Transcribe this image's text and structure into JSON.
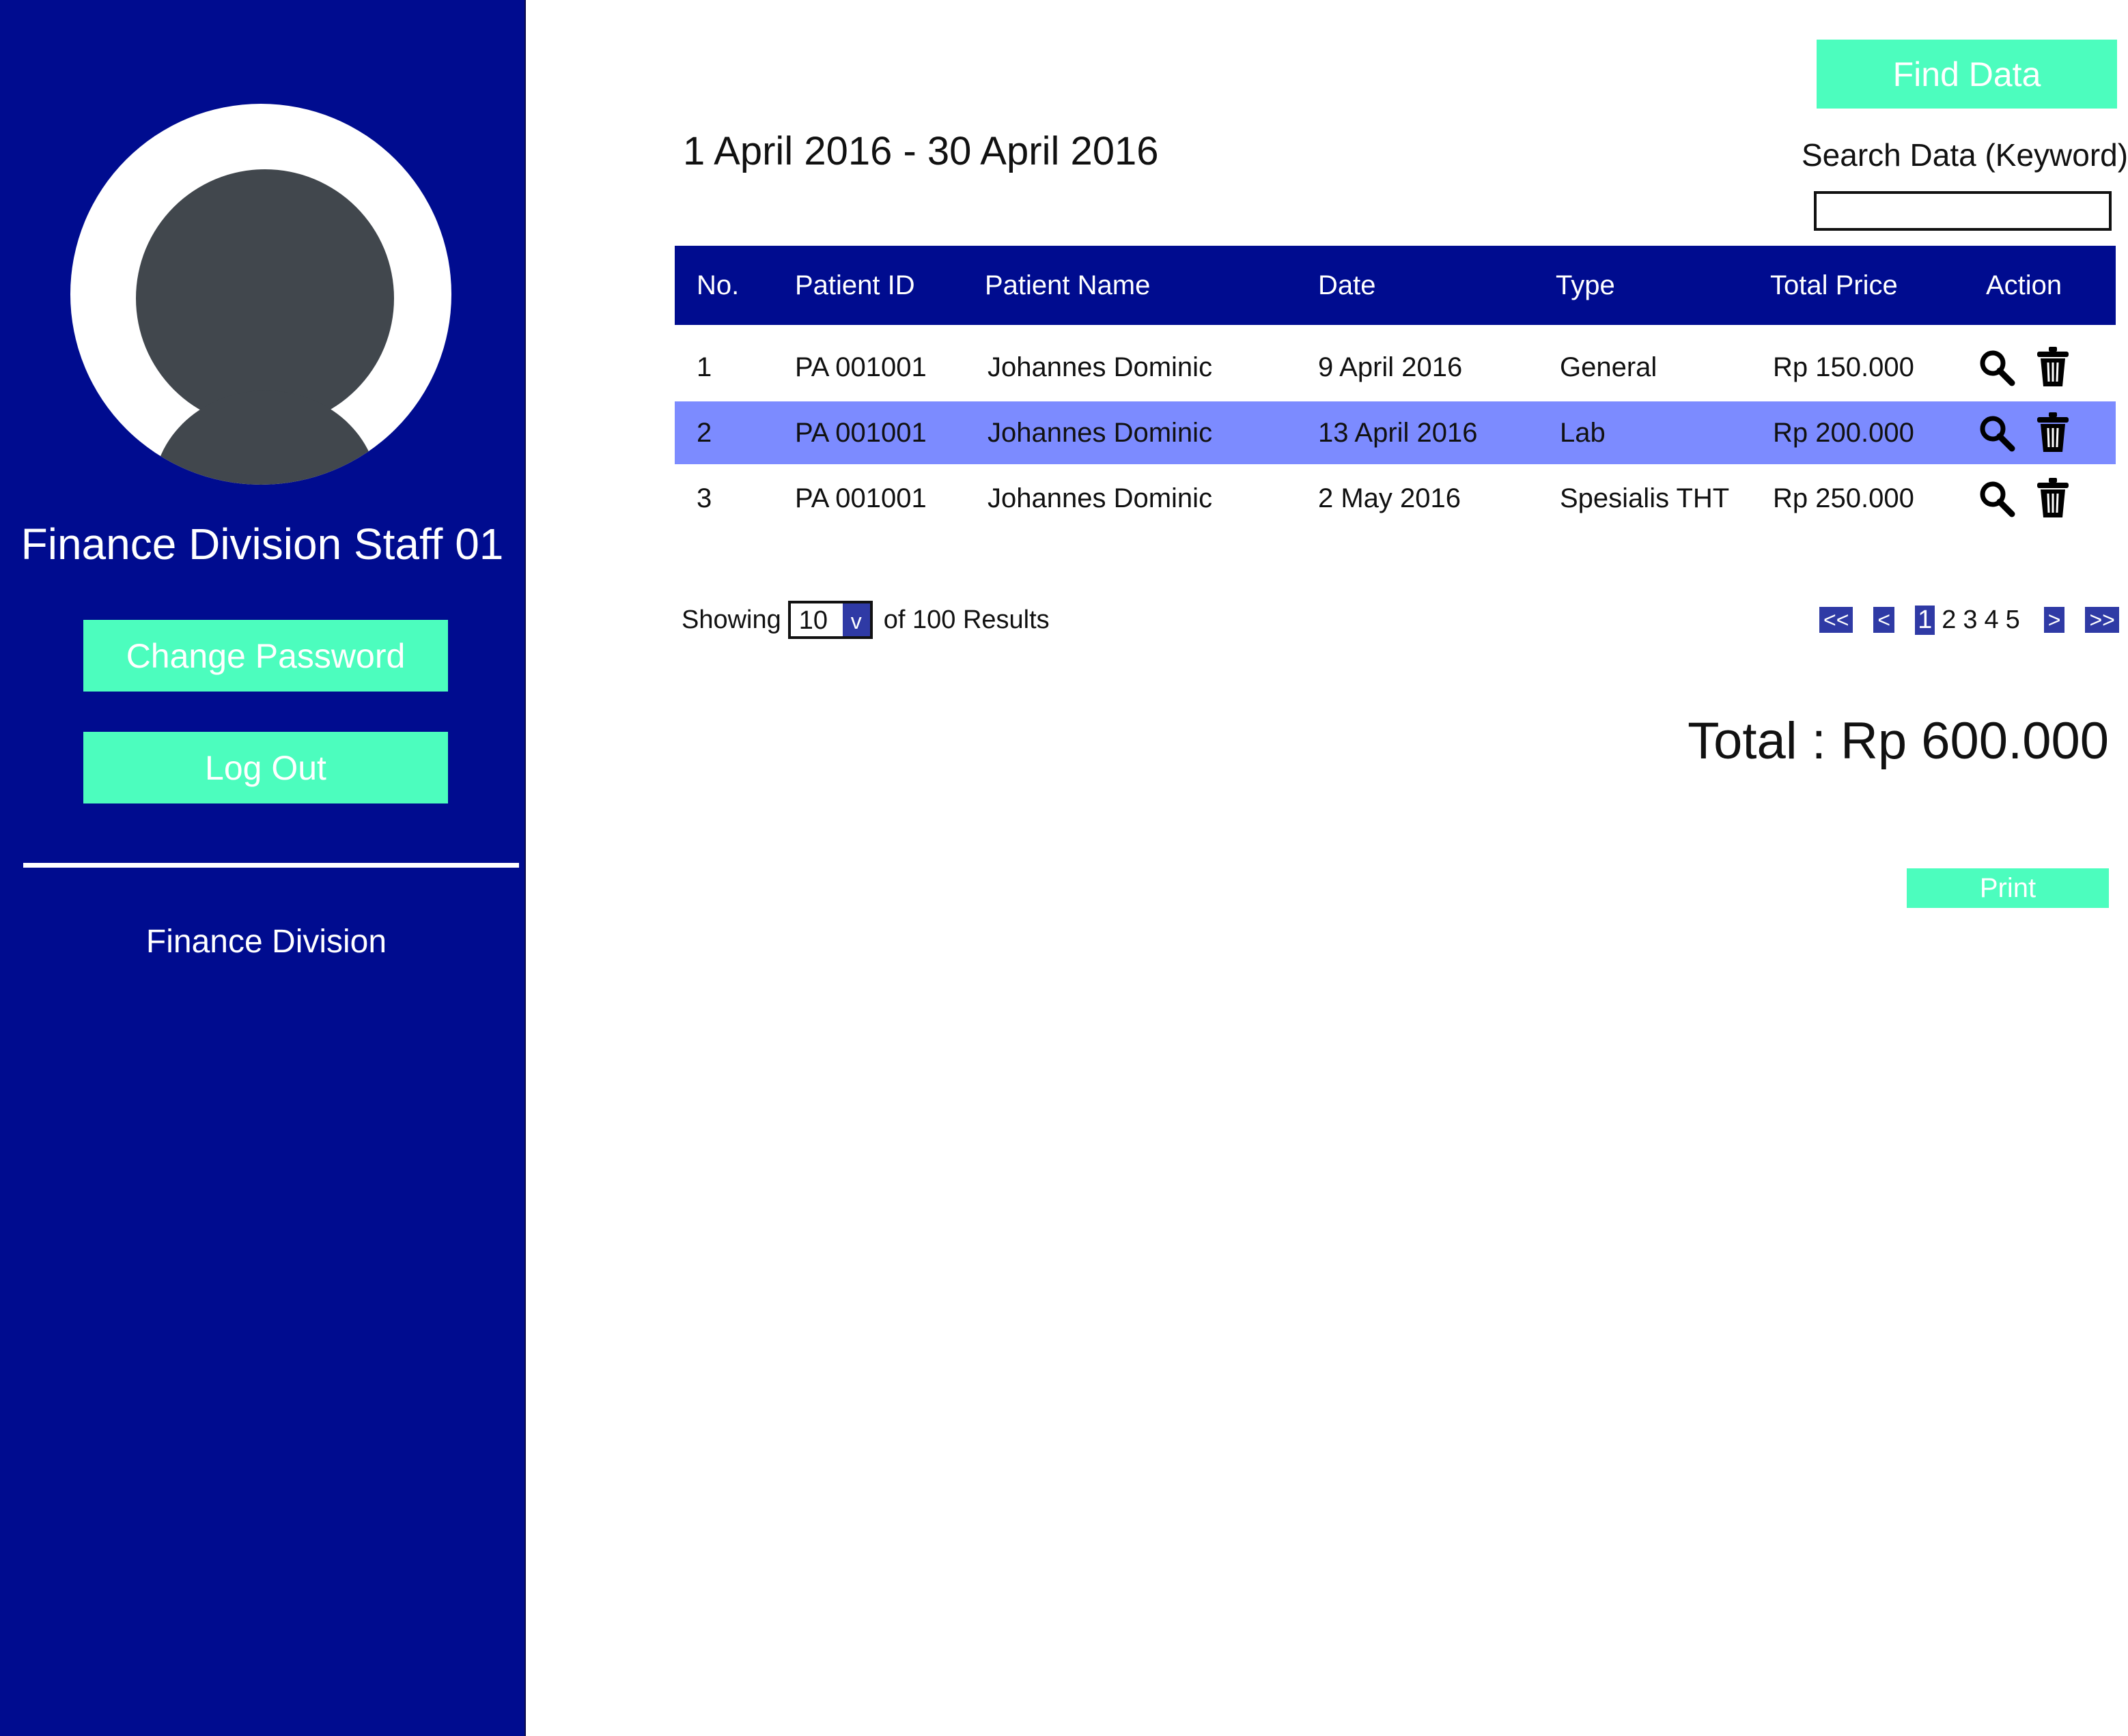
{
  "colors": {
    "sidebar_bg": "#000c8f",
    "accent_button": "#4cfdbe",
    "row_highlight": "#7c8bff",
    "avatar_silhouette": "#41474d",
    "pager_button": "#2f3aa5"
  },
  "sidebar": {
    "avatar_icon": "user-avatar-icon",
    "staff_name": "Finance Division Staff 01",
    "change_password_label": "Change Password",
    "logout_label": "Log Out",
    "section_label": "Finance Division"
  },
  "header": {
    "find_button_label": "Find Data",
    "date_range": "1 April 2016 - 30 April 2016",
    "search_label": "Search Data (Keyword)",
    "search_value": ""
  },
  "table": {
    "columns": [
      "No.",
      "Patient ID",
      "Patient Name",
      "Date",
      "Type",
      "Total Price",
      "Action"
    ],
    "rows": [
      {
        "no": "1",
        "patient_id": "PA 001001",
        "patient_name": "Johannes Dominic",
        "date": "9 April 2016",
        "type": "General",
        "total_price": "Rp 150.000",
        "highlighted": false
      },
      {
        "no": "2",
        "patient_id": "PA 001001",
        "patient_name": "Johannes Dominic",
        "date": "13 April 2016",
        "type": "Lab",
        "total_price": "Rp 200.000",
        "highlighted": true
      },
      {
        "no": "3",
        "patient_id": "PA 001001",
        "patient_name": "Johannes Dominic",
        "date": "2 May 2016",
        "type": "Spesialis THT",
        "total_price": "Rp 250.000",
        "highlighted": false
      }
    ],
    "action_icons": [
      "search-icon",
      "trash-icon"
    ]
  },
  "footer": {
    "showing_label": "Showing",
    "page_size": "10",
    "select_arrow": "v",
    "results_label": "of 100 Results",
    "pager": {
      "first": "<<",
      "prev": "<",
      "pages": [
        "1",
        "2",
        "3",
        "4",
        "5"
      ],
      "active_page": "1",
      "next": ">",
      "last": ">>"
    },
    "total": "Total : Rp 600.000",
    "print_label": "Print"
  }
}
